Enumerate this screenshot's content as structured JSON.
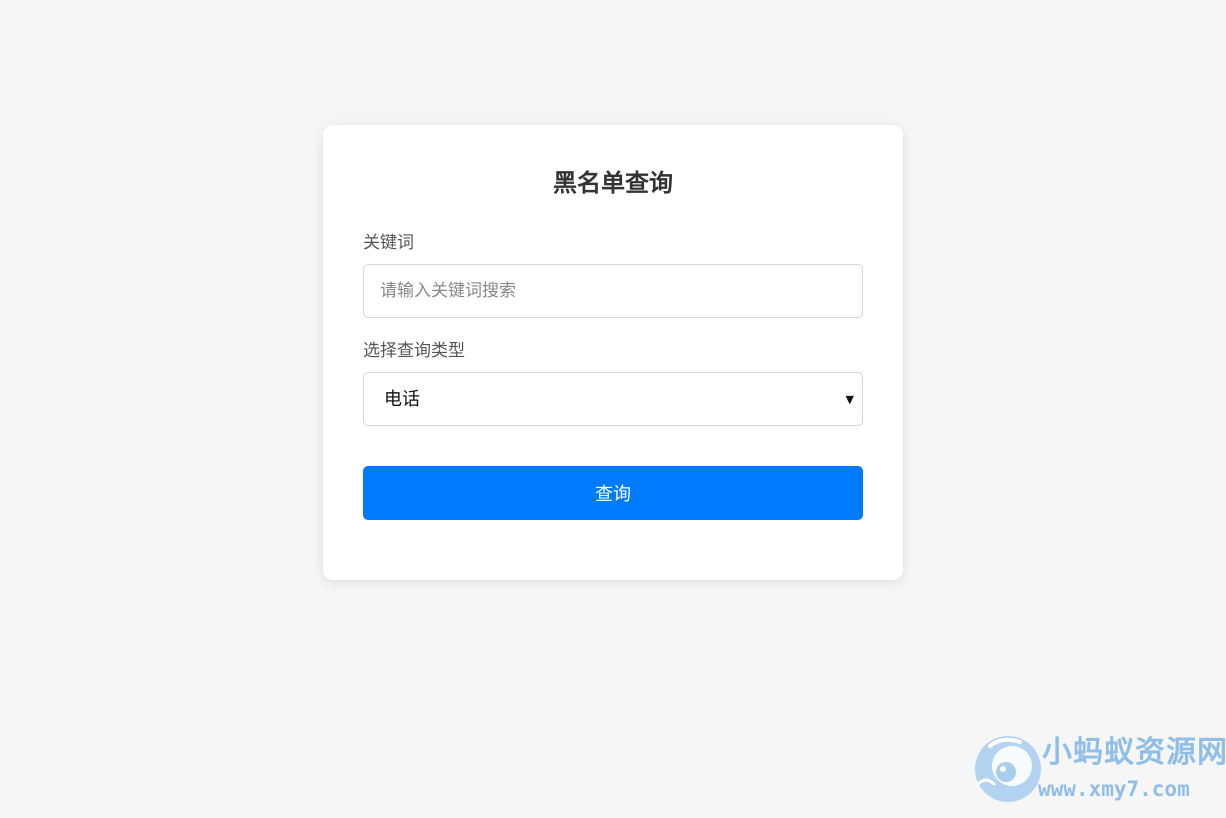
{
  "form": {
    "title": "黑名单查询",
    "keyword_label": "关键词",
    "keyword_value": "",
    "keyword_placeholder": "请输入关键词搜索",
    "type_label": "选择查询类型",
    "type_selected": "电话",
    "submit_label": "查询"
  },
  "watermark": {
    "name": "小蚂蚁资源网",
    "url": "www.xmy7.com"
  },
  "icons": {
    "select_caret": "chevron-down-icon",
    "watermark_logo": "ant-logo-icon"
  },
  "colors": {
    "background": "#f6f6f6",
    "card": "#ffffff",
    "primary_button": "#007bff",
    "watermark": "#8fbfe8"
  }
}
